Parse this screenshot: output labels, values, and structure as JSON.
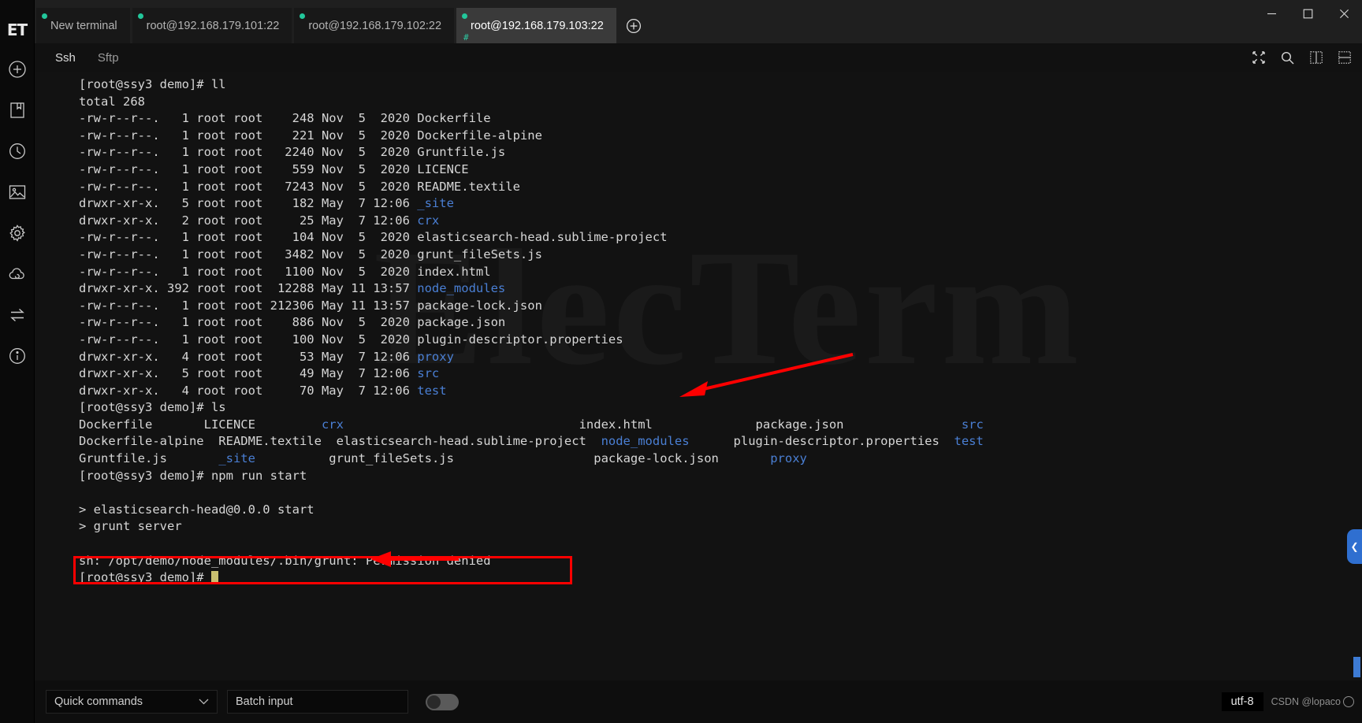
{
  "window": {
    "minimize_label": "─",
    "maximize_label": "❐",
    "close_label": "✕"
  },
  "rail": {
    "logo": "ET",
    "items": [
      {
        "name": "new-connection-icon",
        "label": "New connection"
      },
      {
        "name": "bookmark-icon",
        "label": "Bookmarks"
      },
      {
        "name": "history-icon",
        "label": "History"
      },
      {
        "name": "image-icon",
        "label": "Images"
      },
      {
        "name": "settings-icon",
        "label": "Settings"
      },
      {
        "name": "cloud-icon",
        "label": "Cloud"
      },
      {
        "name": "transfer-icon",
        "label": "Transfer"
      },
      {
        "name": "info-icon",
        "label": "Info"
      }
    ]
  },
  "tabs": [
    {
      "label": "New terminal",
      "active": false,
      "sub": ""
    },
    {
      "label": "root@192.168.179.101:22",
      "active": false,
      "sub": ""
    },
    {
      "label": "root@192.168.179.102:22",
      "active": false,
      "sub": ""
    },
    {
      "label": "root@192.168.179.103:22",
      "active": true,
      "sub": "#"
    }
  ],
  "add_tab_label": "+",
  "subbar": {
    "ssh_label": "Ssh",
    "sftp_label": "Sftp",
    "icons": [
      {
        "name": "fullscreen-icon"
      },
      {
        "name": "search-icon"
      },
      {
        "name": "split-vertical-icon"
      },
      {
        "name": "split-horizontal-icon"
      }
    ]
  },
  "terminal": {
    "watermark": "ElecTerm",
    "prompt": "[root@ssy3 demo]#",
    "lines": [
      {
        "segments": [
          {
            "text": "[root@ssy3 demo]# ll"
          }
        ]
      },
      {
        "segments": [
          {
            "text": "total 268"
          }
        ]
      },
      {
        "segments": [
          {
            "text": "-rw-r--r--.   1 root root    248 Nov  5  2020 Dockerfile"
          }
        ]
      },
      {
        "segments": [
          {
            "text": "-rw-r--r--.   1 root root    221 Nov  5  2020 Dockerfile-alpine"
          }
        ]
      },
      {
        "segments": [
          {
            "text": "-rw-r--r--.   1 root root   2240 Nov  5  2020 Gruntfile.js"
          }
        ]
      },
      {
        "segments": [
          {
            "text": "-rw-r--r--.   1 root root    559 Nov  5  2020 LICENCE"
          }
        ]
      },
      {
        "segments": [
          {
            "text": "-rw-r--r--.   1 root root   7243 Nov  5  2020 README.textile"
          }
        ]
      },
      {
        "segments": [
          {
            "text": "drwxr-xr-x.   5 root root    182 May  7 12:06 "
          },
          {
            "text": "_site",
            "cls": "dir"
          }
        ]
      },
      {
        "segments": [
          {
            "text": "drwxr-xr-x.   2 root root     25 May  7 12:06 "
          },
          {
            "text": "crx",
            "cls": "dir"
          }
        ]
      },
      {
        "segments": [
          {
            "text": "-rw-r--r--.   1 root root    104 Nov  5  2020 elasticsearch-head.sublime-project"
          }
        ]
      },
      {
        "segments": [
          {
            "text": "-rw-r--r--.   1 root root   3482 Nov  5  2020 grunt_fileSets.js"
          }
        ]
      },
      {
        "segments": [
          {
            "text": "-rw-r--r--.   1 root root   1100 Nov  5  2020 index.html"
          }
        ]
      },
      {
        "segments": [
          {
            "text": "drwxr-xr-x. 392 root root  12288 May 11 13:57 "
          },
          {
            "text": "node_modules",
            "cls": "dir"
          }
        ]
      },
      {
        "segments": [
          {
            "text": "-rw-r--r--.   1 root root 212306 May 11 13:57 package-lock.json"
          }
        ]
      },
      {
        "segments": [
          {
            "text": "-rw-r--r--.   1 root root    886 Nov  5  2020 package.json"
          }
        ]
      },
      {
        "segments": [
          {
            "text": "-rw-r--r--.   1 root root    100 Nov  5  2020 plugin-descriptor.properties"
          }
        ]
      },
      {
        "segments": [
          {
            "text": "drwxr-xr-x.   4 root root     53 May  7 12:06 "
          },
          {
            "text": "proxy",
            "cls": "dir"
          }
        ]
      },
      {
        "segments": [
          {
            "text": "drwxr-xr-x.   5 root root     49 May  7 12:06 "
          },
          {
            "text": "src",
            "cls": "dir"
          }
        ]
      },
      {
        "segments": [
          {
            "text": "drwxr-xr-x.   4 root root     70 May  7 12:06 "
          },
          {
            "text": "test",
            "cls": "dir"
          }
        ]
      },
      {
        "segments": [
          {
            "text": "[root@ssy3 demo]# ls"
          }
        ]
      },
      {
        "segments": [
          {
            "text": "Dockerfile       LICENCE         "
          },
          {
            "text": "crx",
            "cls": "dir"
          },
          {
            "text": "                                index.html              package.json                "
          },
          {
            "text": "src",
            "cls": "dir"
          }
        ]
      },
      {
        "segments": [
          {
            "text": "Dockerfile-alpine  README.textile  elasticsearch-head.sublime-project  "
          },
          {
            "text": "node_modules",
            "cls": "dir"
          },
          {
            "text": "      plugin-descriptor.properties  "
          },
          {
            "text": "test",
            "cls": "dir"
          }
        ]
      },
      {
        "segments": [
          {
            "text": "Gruntfile.js       "
          },
          {
            "text": "_site",
            "cls": "dir"
          },
          {
            "text": "          grunt_fileSets.js                   package-lock.json       "
          },
          {
            "text": "proxy",
            "cls": "dir"
          }
        ]
      },
      {
        "segments": [
          {
            "text": "[root@ssy3 demo]# npm run start"
          }
        ]
      },
      {
        "segments": [
          {
            "text": ""
          }
        ]
      },
      {
        "segments": [
          {
            "text": "> elasticsearch-head@0.0.0 start"
          }
        ]
      },
      {
        "segments": [
          {
            "text": "> grunt server"
          }
        ]
      },
      {
        "segments": [
          {
            "text": ""
          }
        ]
      },
      {
        "segments": [
          {
            "text": "sh: /opt/demo/node_modules/.bin/grunt: Permission denied"
          }
        ]
      },
      {
        "segments": [
          {
            "text": "[root@ssy3 demo]# ",
            "cursor": true
          }
        ]
      }
    ],
    "annotations": {
      "arrow_color": "#fe0000",
      "error_box_color": "#fe0000",
      "error_text": "sh: /opt/demo/node_modules/.bin/grunt: Permission denied",
      "arrow_top_target": "package-lock.json",
      "arrow_bottom_target": "npm run start"
    }
  },
  "bottombar": {
    "quick_commands_label": "Quick commands",
    "batch_input_label": "Batch input",
    "batch_input_enabled": false,
    "encoding_label": "utf-8",
    "watermark": "CSDN @lopaco"
  }
}
